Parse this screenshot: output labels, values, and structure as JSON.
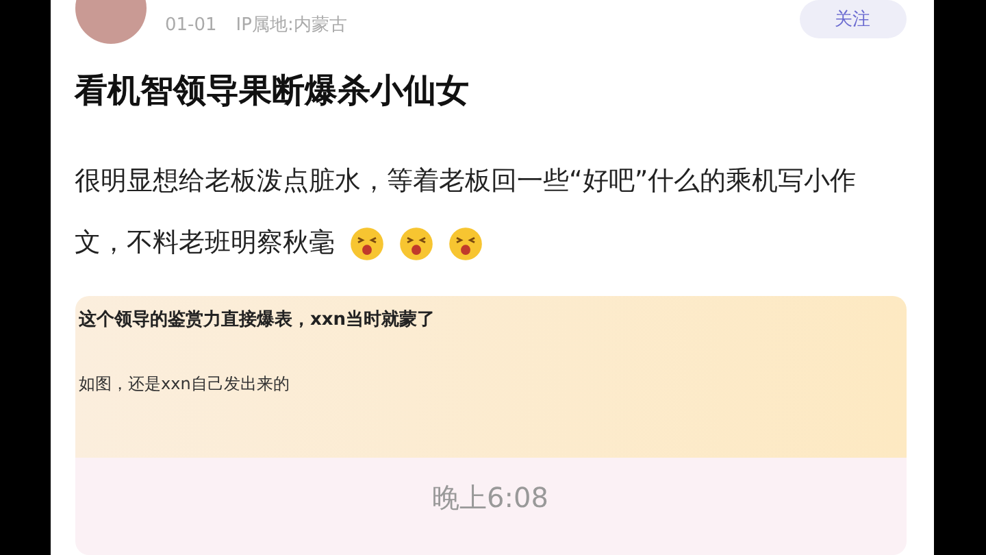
{
  "post": {
    "date": "01-01",
    "ip_location": "IP属地:内蒙古",
    "follow_button": "关注",
    "title": "看机智领导果断爆杀小仙女",
    "body": "很明显想给老板泼点脏水，等着老板回一些“好吧”什么的乘机写小作文，不料老班明察秋毫",
    "emojis": [
      {
        "kind": "laughing"
      },
      {
        "kind": "laughing"
      },
      {
        "kind": "laughing"
      }
    ]
  },
  "embedded_screenshot": {
    "headline": "这个领导的鉴赏力直接爆表，xxn当时就蒙了",
    "caption": "如图，还是xxn自己发出来的",
    "time": "晚上6:08"
  }
}
